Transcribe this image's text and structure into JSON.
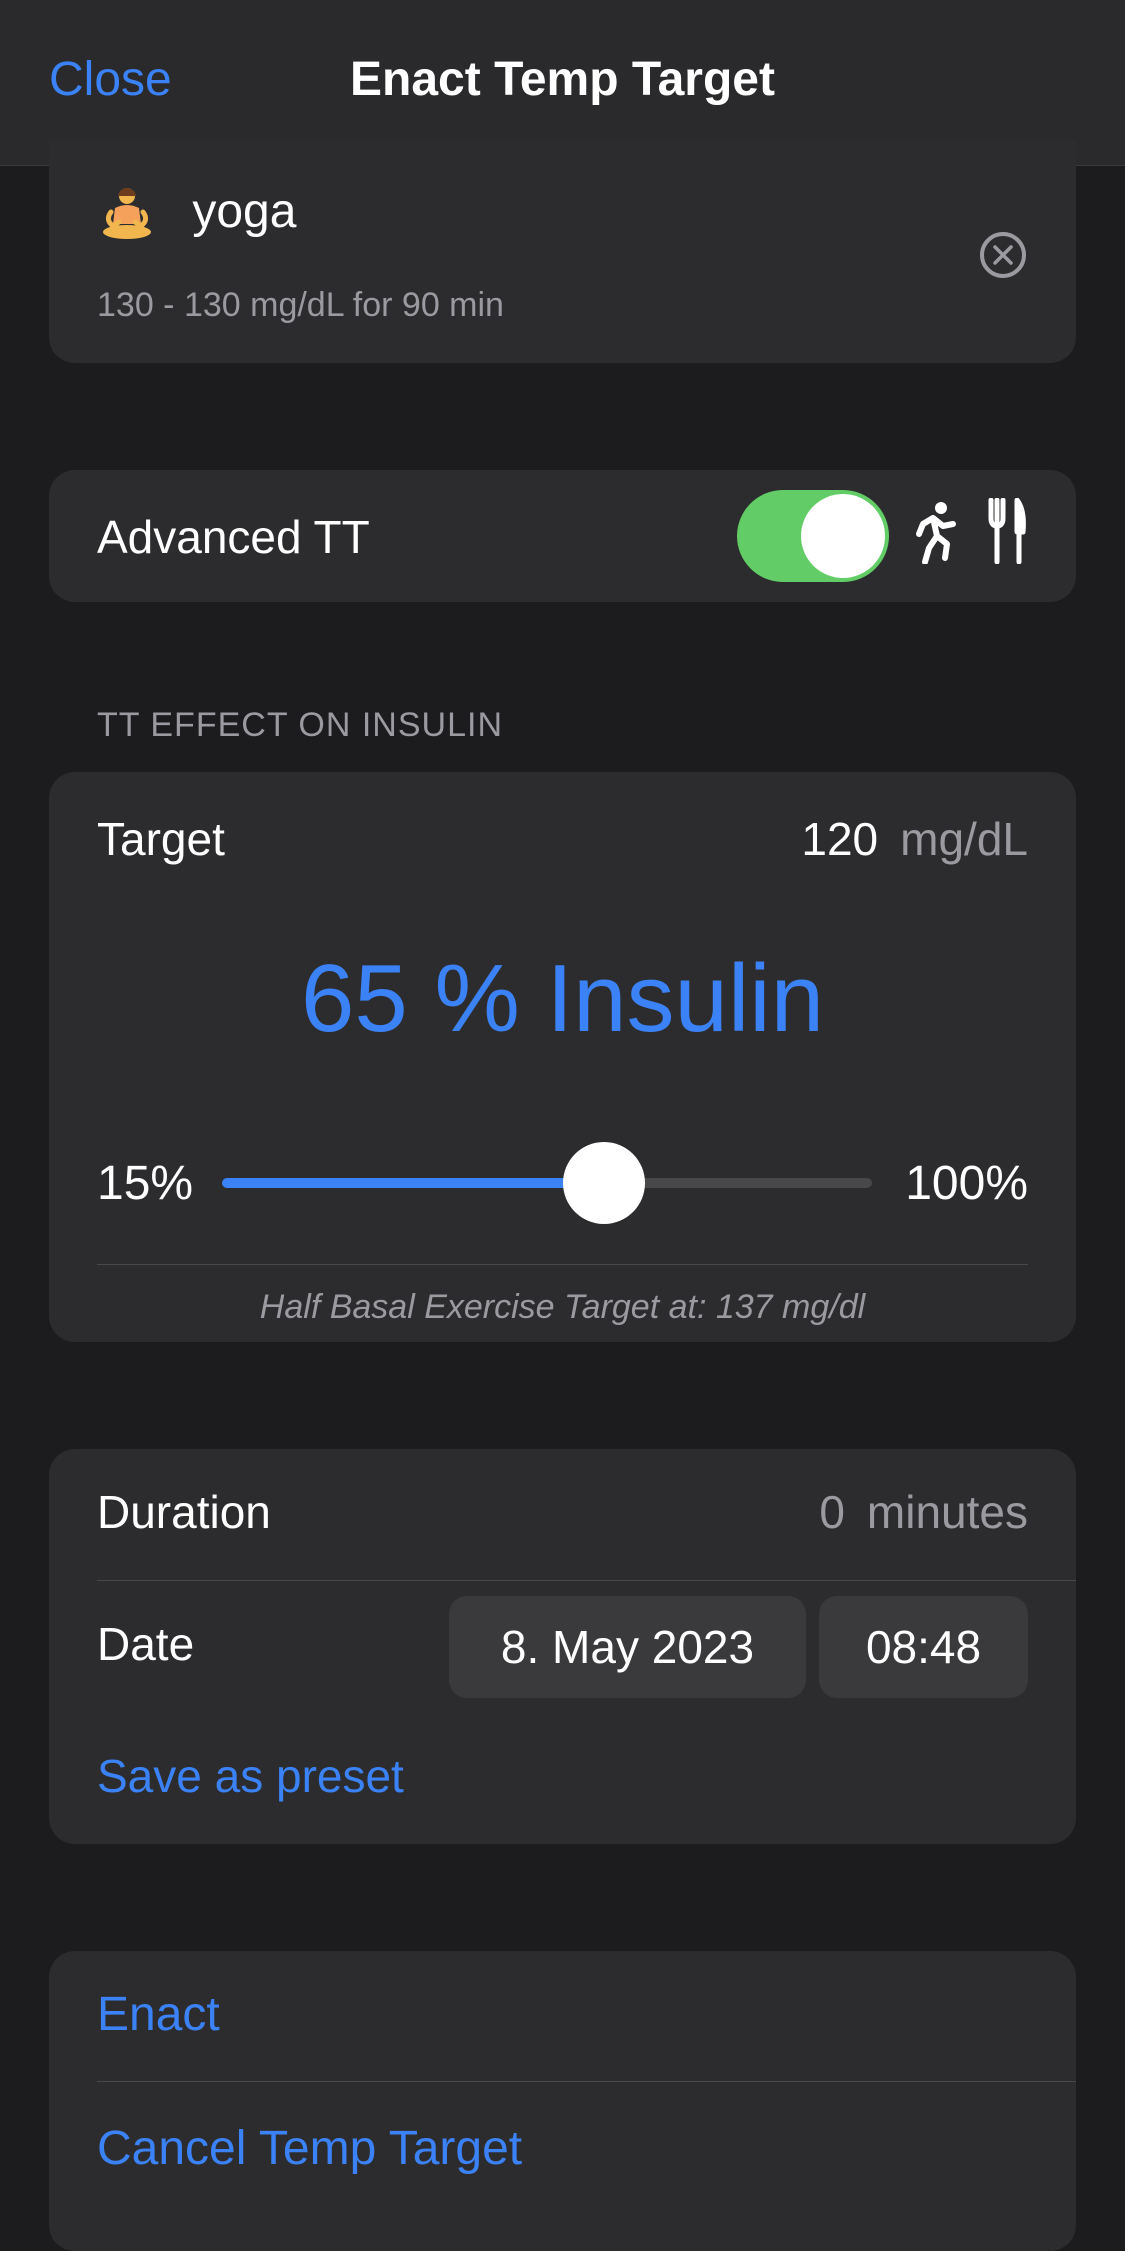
{
  "nav": {
    "close_label": "Close",
    "title": "Enact Temp Target"
  },
  "preset": {
    "emoji": "meditation-person-icon",
    "name": "yoga",
    "subtitle": "130 - 130 mg/dL for 90 min",
    "clear_icon": "circle-x-icon"
  },
  "advanced": {
    "label": "Advanced TT",
    "toggle_on": true,
    "icons": [
      "running-icon",
      "fork-knife-icon"
    ]
  },
  "effect": {
    "section_header": "TT EFFECT ON INSULIN",
    "target_label": "Target",
    "target_value": "120",
    "target_unit": "mg/dL",
    "insulin_text": "65 % Insulin",
    "slider_min": "15%",
    "slider_max": "100%",
    "slider_value": 65,
    "slider_range": [
      15,
      100
    ],
    "note": "Half Basal Exercise Target at: 137 mg/dl"
  },
  "duration": {
    "label": "Duration",
    "value": "0",
    "unit": "minutes",
    "date_label": "Date",
    "date_value": "8. May 2023",
    "time_value": "08:48",
    "save_preset": "Save as preset"
  },
  "actions": {
    "enact": "Enact",
    "cancel": "Cancel Temp Target"
  },
  "colors": {
    "accent": "#3b82f6",
    "toggle_on": "#62cd66",
    "background": "#1c1c1e",
    "card": "#2c2c2e"
  }
}
